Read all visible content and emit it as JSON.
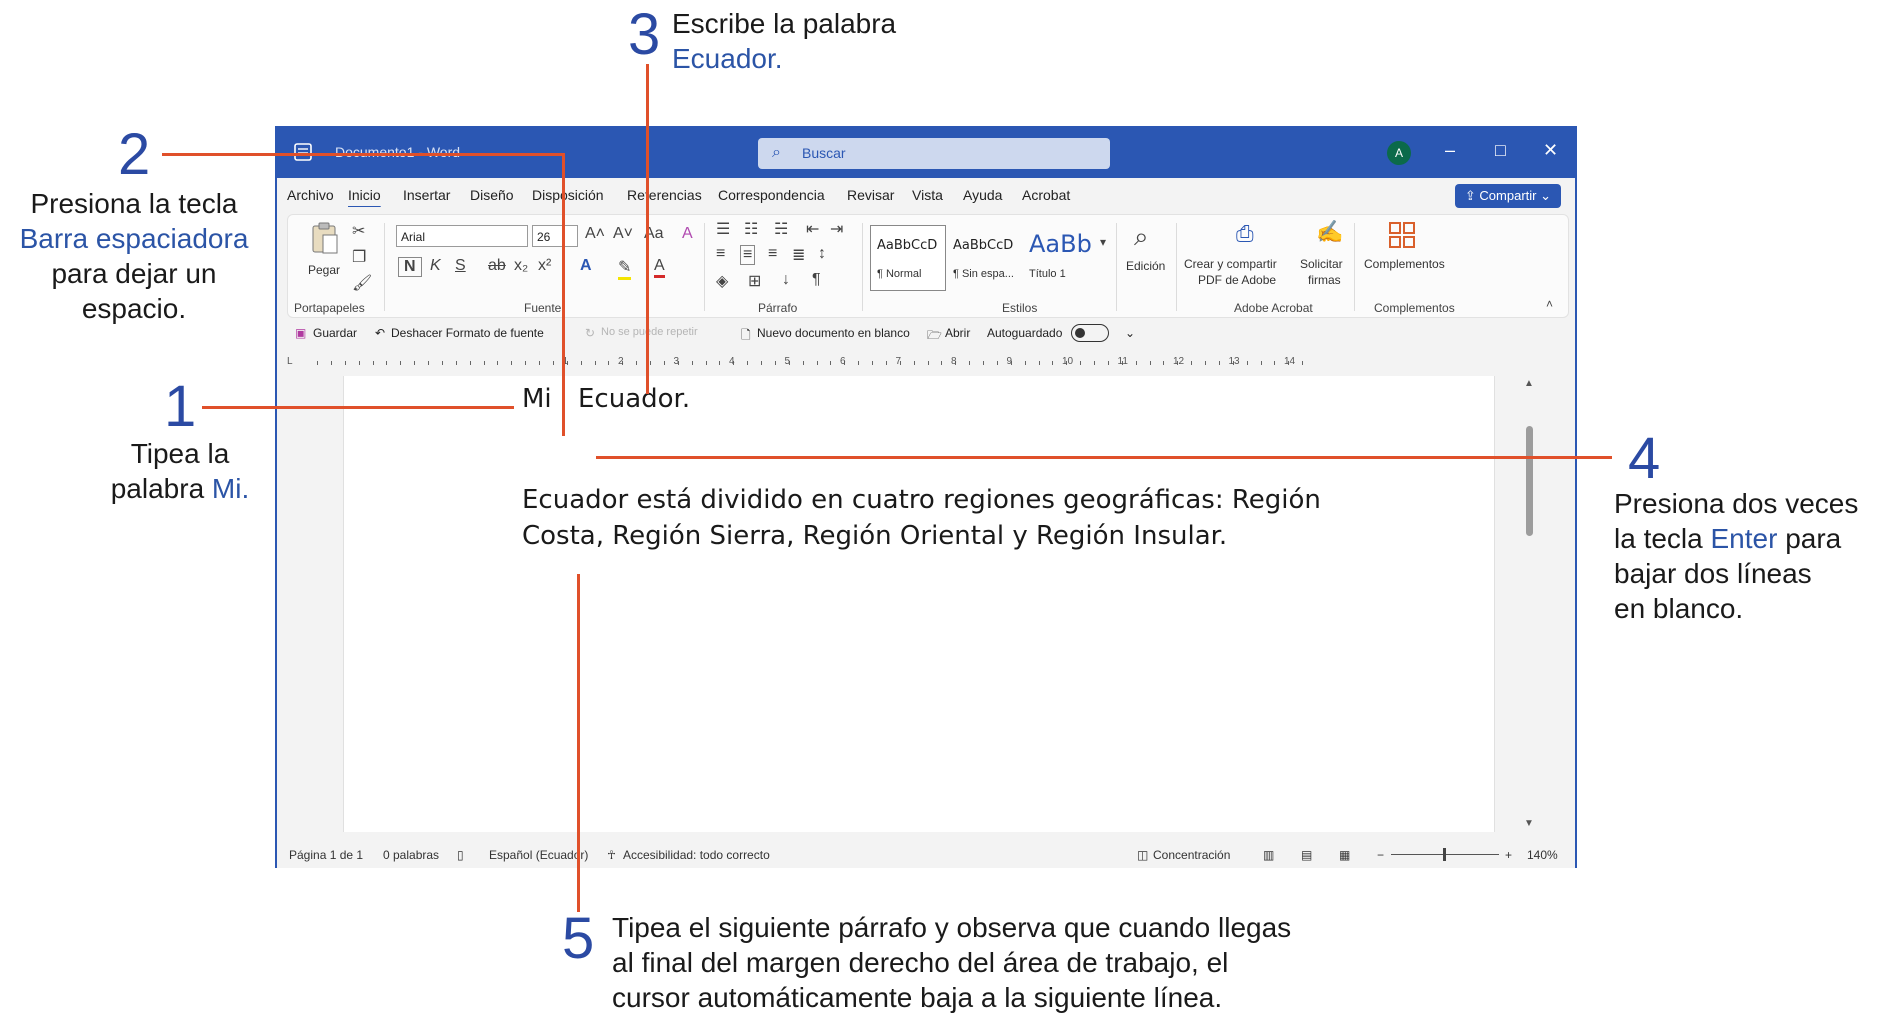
{
  "callouts": {
    "c1": {
      "number": "1",
      "text_a": "Tipea la",
      "text_b": "palabra ",
      "highlight": "Mi."
    },
    "c2": {
      "number": "2",
      "line1": "Presiona la tecla",
      "highlight": "Barra espaciadora",
      "line3": "para dejar un",
      "line4": "espacio."
    },
    "c3": {
      "number": "3",
      "line1": "Escribe la palabra",
      "highlight": "Ecuador."
    },
    "c4": {
      "number": "4",
      "line1": "Presiona dos veces",
      "line2_a": "la tecla ",
      "highlight": "Enter",
      "line2_b": " para",
      "line3": "bajar dos líneas",
      "line4": "en blanco."
    },
    "c5": {
      "number": "5",
      "line1": "Tipea el siguiente párrafo y observa que cuando llegas",
      "line2": "al final del margen derecho del área de trabajo, el",
      "line3": "cursor automáticamente baja a la siguiente línea."
    }
  },
  "window": {
    "title": "Documento1 - Word",
    "search_placeholder": "Buscar",
    "avatar_initial": "A",
    "minimize": "–",
    "maximize": "□",
    "close": "✕"
  },
  "tabs": [
    "Archivo",
    "Inicio",
    "Insertar",
    "Diseño",
    "Disposición",
    "Referencias",
    "Correspondencia",
    "Revisar",
    "Vista",
    "Ayuda",
    "Acrobat"
  ],
  "share_label": "Compartir",
  "ribbon": {
    "paste_label": "Pegar",
    "font_name": "Arial",
    "font_size": "26",
    "bold": "N",
    "italic": "K",
    "underline": "S",
    "styles": [
      {
        "preview": "AaBbCcD",
        "name": "¶ Normal"
      },
      {
        "preview": "AaBbCcD",
        "name": "¶ Sin espa..."
      },
      {
        "preview": "AaBb",
        "name": "Título 1"
      }
    ],
    "edicion": "Edición",
    "acrobat_create_1": "Crear y compartir",
    "acrobat_create_2": "PDF de Adobe",
    "acrobat_sign_1": "Solicitar",
    "acrobat_sign_2": "firmas",
    "complementos": "Complementos",
    "groups": [
      "Portapapeles",
      "Fuente",
      "Párrafo",
      "Estilos",
      "Adobe Acrobat",
      "Complementos"
    ]
  },
  "qat": {
    "save": "Guardar",
    "undo": "Deshacer Formato de fuente",
    "redo": "No se puede repetir",
    "new_doc": "Nuevo documento en blanco",
    "open": "Abrir",
    "autosave": "Autoguardado"
  },
  "ruler_numbers": [
    "1",
    "2",
    "3",
    "4",
    "5",
    "6",
    "7",
    "8",
    "9",
    "10",
    "11",
    "12",
    "13",
    "14"
  ],
  "document": {
    "line1_word1": "Mi",
    "line1_word2": "Ecuador.",
    "para_line1": "Ecuador está dividido en cuatro regiones geográficas: Región",
    "para_line2": "Costa, Región Sierra, Región Oriental y Región Insular."
  },
  "status": {
    "page": "Página 1 de 1",
    "words": "0 palabras",
    "language": "Español (Ecuador)",
    "accessibility": "Accesibilidad: todo correcto",
    "focus": "Concentración",
    "zoom": "140%"
  },
  "colors": {
    "accent": "#2b57b3",
    "callout_line": "#e0502a",
    "callout_number": "#2b4aa3"
  }
}
